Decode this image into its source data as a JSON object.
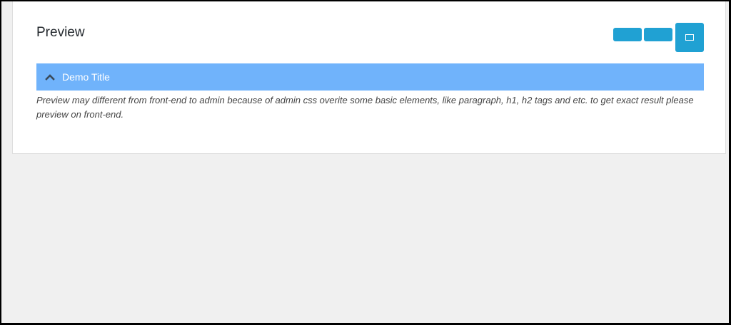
{
  "panel": {
    "title": "Preview"
  },
  "toolbar": {
    "buttons": [
      {
        "icon": "blank-button",
        "color": "#20a1d3"
      },
      {
        "icon": "blank-button",
        "color": "#20a1d3"
      },
      {
        "icon": "window-icon",
        "color": "#20a1d3"
      }
    ]
  },
  "accordion": {
    "title": "Demo Title",
    "icon": "chevron-up-icon",
    "background": "#70b3fb"
  },
  "note": {
    "text": "Preview may different from front-end to admin because of admin css overite some basic elements, like paragraph, h1, h2 tags and etc. to get exact result please preview on front-end."
  }
}
